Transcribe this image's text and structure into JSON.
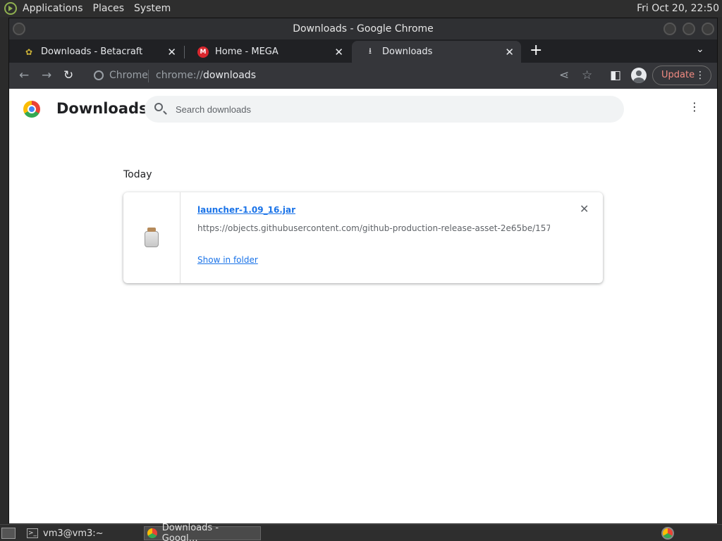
{
  "desktop": {
    "menus": [
      "Applications",
      "Places",
      "System"
    ],
    "clock": "Fri Oct 20, 22:50"
  },
  "window": {
    "title": "Downloads - Google Chrome"
  },
  "tabs": [
    {
      "title": "Downloads - Betacraft",
      "favicon": "betacraft-icon",
      "active": false
    },
    {
      "title": "Home - MEGA",
      "favicon": "mega-icon",
      "active": false
    },
    {
      "title": "Downloads",
      "favicon": "download-icon",
      "active": true
    }
  ],
  "toolbar": {
    "site_label": "Chrome",
    "url_scheme": "chrome://",
    "url_host": "downloads",
    "update_label": "Update"
  },
  "page": {
    "title": "Downloads",
    "search_placeholder": "Search downloads",
    "date_group": "Today",
    "items": [
      {
        "filename": "launcher-1.09_16.jar",
        "url": "https://objects.githubusercontent.com/github-production-release-asset-2e65be/157…",
        "action": "Show in folder",
        "icon": "jar-file-icon"
      }
    ]
  },
  "taskbar": {
    "items": [
      {
        "label": "vm3@vm3:~",
        "icon": "terminal-icon"
      },
      {
        "label": "Downloads - Googl…",
        "icon": "chrome-icon"
      }
    ]
  },
  "colors": {
    "link": "#1a73e8",
    "update_accent": "#f28b82",
    "chrome_dark": "#35363a"
  }
}
